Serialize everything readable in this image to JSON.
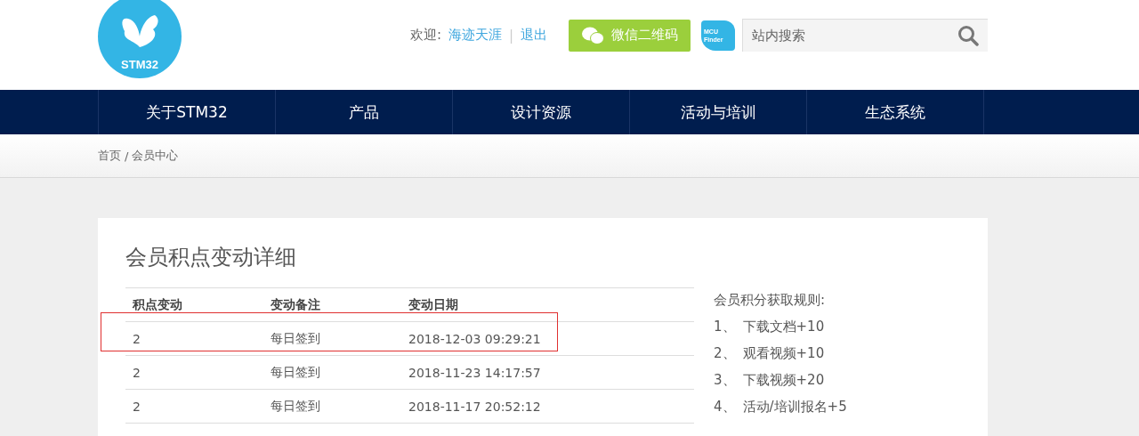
{
  "header": {
    "logo_text": "STM32",
    "welcome": "欢迎:",
    "username": "海迹天涯",
    "separator": "|",
    "logout": "退出",
    "wechat_button": "微信二维码",
    "mcu_finder": {
      "line1": "MCU",
      "line2": "Finder"
    },
    "search": {
      "placeholder": "站内搜索"
    }
  },
  "nav": [
    {
      "label": "关于STM32",
      "selected": false
    },
    {
      "label": "产品",
      "selected": false
    },
    {
      "label": "设计资源",
      "selected": false
    },
    {
      "label": "活动与培训",
      "selected": false
    },
    {
      "label": "生态系统",
      "selected": false
    }
  ],
  "breadcrumb": [
    "首页",
    "/",
    "会员中心"
  ],
  "title": "会员积点变动详细",
  "table": {
    "columns": [
      "积点变动",
      "变动备注",
      "变动日期"
    ],
    "rows": [
      {
        "cells": [
          "2",
          "每日签到",
          "2018-12-03 09:29:21"
        ],
        "highlighted": true
      },
      {
        "cells": [
          "2",
          "每日签到",
          "2018-11-23 14:17:57"
        ],
        "highlighted": false
      },
      {
        "cells": [
          "2",
          "每日签到",
          "2018-11-17 20:52:12"
        ],
        "highlighted": false
      }
    ]
  },
  "rules": {
    "title": "会员积分获取规则:",
    "items": [
      {
        "number": "1、",
        "text": "下载文档+10"
      },
      {
        "number": "2、",
        "text": "观看视频+10"
      },
      {
        "number": "3、",
        "text": "下载视频+20"
      },
      {
        "number": "4、",
        "text": "活动/培训报名+5"
      }
    ]
  }
}
